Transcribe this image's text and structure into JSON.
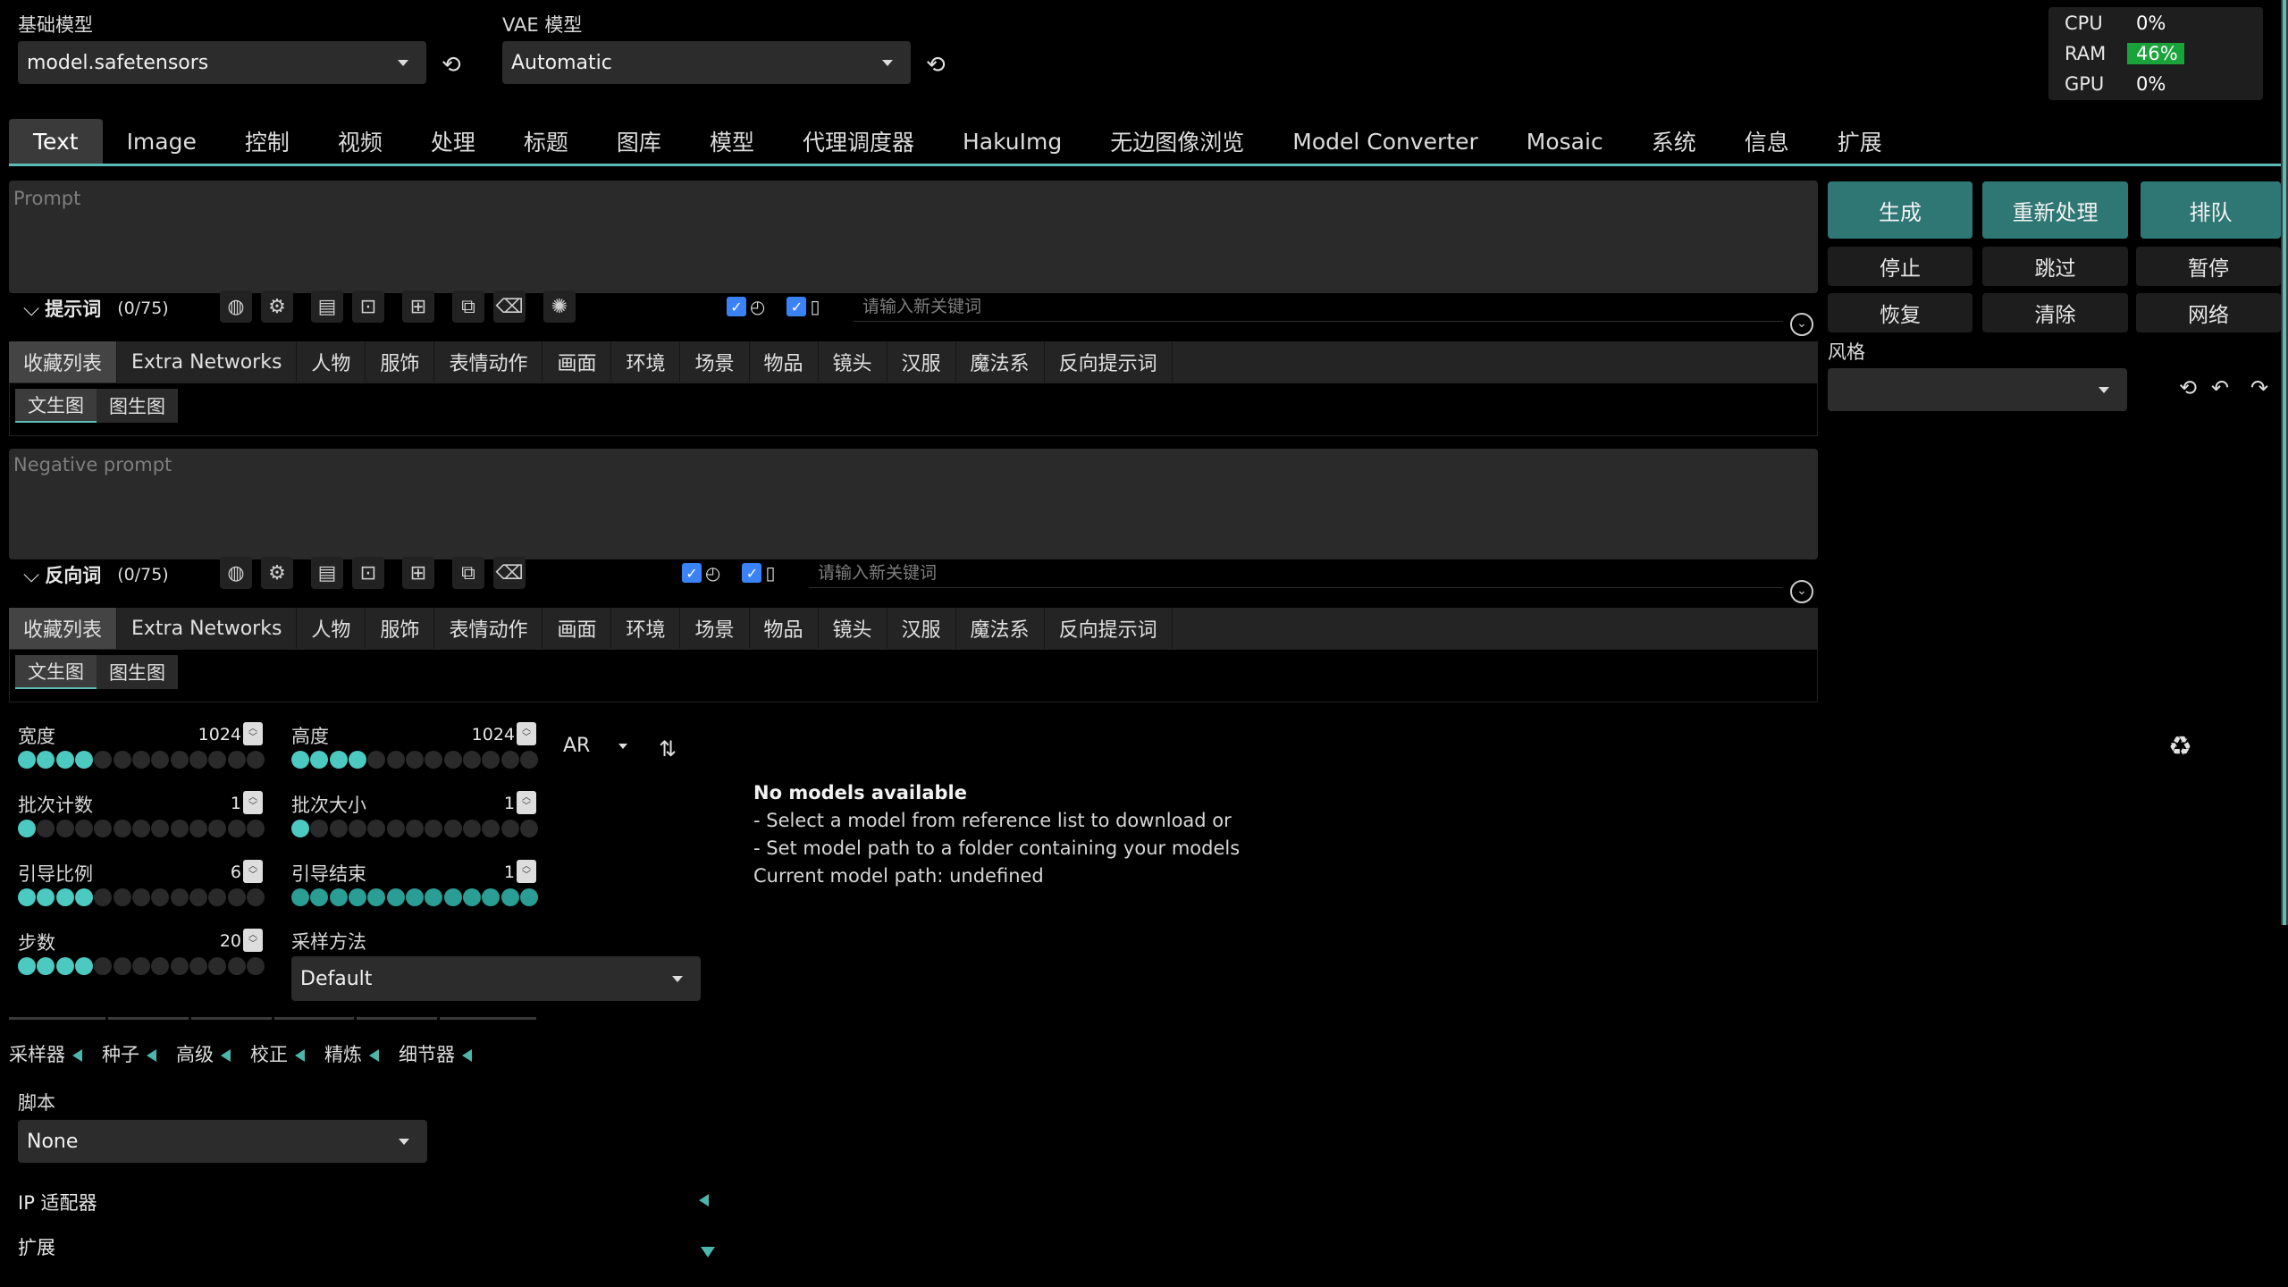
{
  "header": {
    "base_model_label": "基础模型",
    "base_model_value": "model.safetensors",
    "vae_label": "VAE 模型",
    "vae_value": "Automatic",
    "refresh_glyph": "⟲"
  },
  "monitor": {
    "rows": [
      {
        "key": "CPU",
        "value": "0%"
      },
      {
        "key": "RAM",
        "value": "46%"
      },
      {
        "key": "GPU",
        "value": "0%"
      }
    ],
    "ram_highlight_color": "#1aa33a"
  },
  "tabs": [
    "Text",
    "Image",
    "控制",
    "视频",
    "处理",
    "标题",
    "图库",
    "模型",
    "代理调度器",
    "HakuImg",
    "无边图像浏览",
    "Model Converter",
    "Mosaic",
    "系统",
    "信息",
    "扩展"
  ],
  "prompt": {
    "placeholder": "Prompt",
    "label": "提示词",
    "count": "(0/75)",
    "keyword_placeholder": "请输入新关键词"
  },
  "negative": {
    "placeholder": "Negative prompt",
    "label": "反向词",
    "count": "(0/75)",
    "keyword_placeholder": "请输入新关键词"
  },
  "categories": [
    "收藏列表",
    "Extra Networks",
    "人物",
    "服饰",
    "表情动作",
    "画面",
    "环境",
    "场景",
    "物品",
    "镜头",
    "汉服",
    "魔法系",
    "反向提示词"
  ],
  "subtabs": [
    "文生图",
    "图生图"
  ],
  "actions": {
    "generate": "生成",
    "reprocess": "重新处理",
    "queue": "排队",
    "stop": "停止",
    "skip": "跳过",
    "pause": "暂停",
    "restore": "恢复",
    "clear": "清除",
    "network": "网络",
    "style_label": "风格"
  },
  "params": {
    "width": {
      "label": "宽度",
      "value": "1024"
    },
    "height": {
      "label": "高度",
      "value": "1024"
    },
    "batch_count": {
      "label": "批次计数",
      "value": "1"
    },
    "batch_size": {
      "label": "批次大小",
      "value": "1"
    },
    "cfg": {
      "label": "引导比例",
      "value": "6"
    },
    "guidance_end": {
      "label": "引导结束",
      "value": "1"
    },
    "steps": {
      "label": "步数",
      "value": "20"
    },
    "sampler_label": "采样方法",
    "sampler_value": "Default",
    "ar_label": "AR",
    "slider_levels": {
      "width": 0.29,
      "height": 0.29,
      "batch_count": 0.0,
      "batch_size": 0.0,
      "cfg": 0.25,
      "guidance_end": 1.0,
      "steps": 0.29
    }
  },
  "accordions": [
    "采样器",
    "种子",
    "高级",
    "校正",
    "精炼",
    "细节器"
  ],
  "script": {
    "label": "脚本",
    "value": "None"
  },
  "ip_adapter": "IP 适配器",
  "extensions": "扩展",
  "models_panel": {
    "title": "No models available",
    "lines": [
      "- Select a model from reference list to download or",
      "- Set model path to a folder containing your models",
      "Current model path: undefined"
    ]
  },
  "colors": {
    "accent": "#2f7774",
    "slider": "#4cc9c0",
    "tab_underline": "#5bbcb6"
  }
}
